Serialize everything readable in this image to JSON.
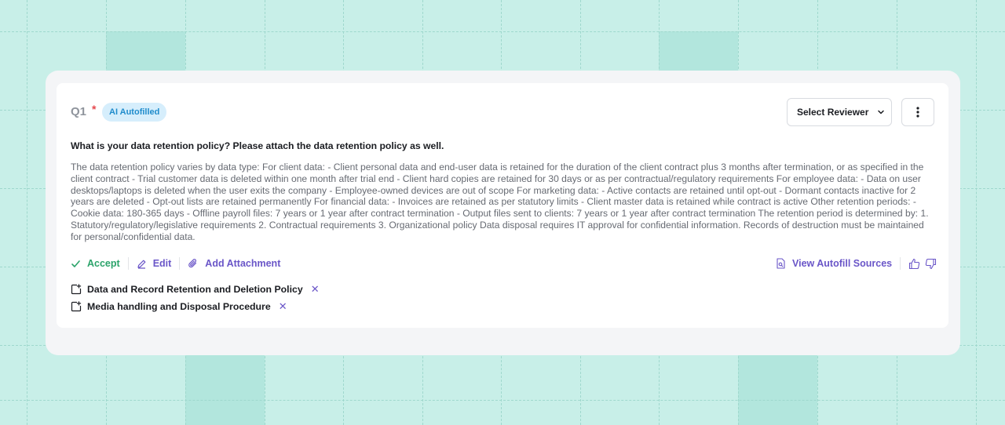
{
  "question": {
    "number": "Q1",
    "required_mark": "*",
    "badge": "AI Autofilled",
    "title": "What is your data retention policy? Please attach the data retention policy as well.",
    "answer": "The data retention policy varies by data type: For client data: - Client personal data and end-user data is retained for the duration of the client contract plus 3 months after termination, or as specified in the client contract - Trial customer data is deleted within one month after trial end - Client hard copies are retained for 30 days or as per contractual/regulatory requirements For employee data: - Data on user desktops/laptops is deleted when the user exits the company - Employee-owned devices are out of scope For marketing data: - Active contacts are retained until opt-out - Dormant contacts inactive for 2 years are deleted - Opt-out lists are retained permanently For financial data: - Invoices are retained as per statutory limits - Client master data is retained while contract is active Other retention periods: - Cookie data: 180-365 days - Offline payroll files: 7 years or 1 year after contract termination - Output files sent to clients: 7 years or 1 year after contract termination The retention period is determined by: 1. Statutory/regulatory/legislative requirements 2. Contractual requirements 3. Organizational policy Data disposal requires IT approval for confidential information. Records of destruction must be maintained for personal/confidential data."
  },
  "header": {
    "reviewer_label": "Select Reviewer"
  },
  "actions": {
    "accept": "Accept",
    "edit": "Edit",
    "add_attachment": "Add Attachment",
    "view_sources": "View Autofill Sources"
  },
  "attachments": [
    {
      "name": "Data and Record Retention and Deletion Policy"
    },
    {
      "name": "Media handling and Disposal Procedure"
    }
  ],
  "icons": {
    "accept": "check-icon",
    "edit": "pencil-icon",
    "attach": "paperclip-icon",
    "sources": "document-search-icon",
    "like": "thumbs-up-icon",
    "dislike": "thumbs-down-icon",
    "doc": "document-link-icon",
    "remove": "close-icon",
    "reviewer_caret": "chevron-down-icon",
    "more": "more-vertical-icon"
  },
  "colors": {
    "accent": "#6a56c8",
    "success": "#2ba36a",
    "badge_bg": "#d6eefc",
    "badge_text": "#1f8ccc",
    "required": "#e5484d",
    "background": "#c8efe8"
  }
}
